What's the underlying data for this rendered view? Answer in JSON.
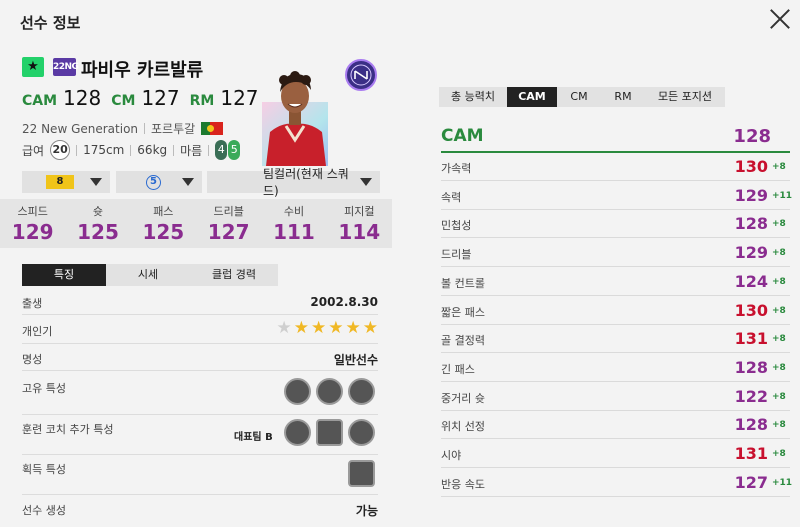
{
  "window": {
    "title": "선수 정보"
  },
  "player": {
    "grade_star": "★",
    "season_badge": "22NG",
    "name": "파비우 카르발류",
    "positions": [
      {
        "label": "CAM",
        "value": "128"
      },
      {
        "label": "CM",
        "value": "127"
      },
      {
        "label": "RM",
        "value": "127"
      }
    ],
    "season_name": "22 New Generation",
    "nation": "포르투갈",
    "salary_label": "급여",
    "salary": "20",
    "height": "175cm",
    "weight": "66kg",
    "body_type": "마름",
    "left_foot": "4",
    "right_foot": "5"
  },
  "selectors": {
    "enhance_level": "8",
    "adaptability": "5",
    "team_color": "팀컬러(현재 스쿼드)"
  },
  "main_stats": [
    {
      "label": "스피드",
      "value": "129"
    },
    {
      "label": "슛",
      "value": "125"
    },
    {
      "label": "패스",
      "value": "125"
    },
    {
      "label": "드리블",
      "value": "127"
    },
    {
      "label": "수비",
      "value": "111"
    },
    {
      "label": "피지컬",
      "value": "114"
    }
  ],
  "tabs": [
    {
      "label": "특징"
    },
    {
      "label": "시세"
    },
    {
      "label": "클럽 경력"
    }
  ],
  "details": {
    "birth_label": "출생",
    "birth_value": "2002.8.30",
    "popularity_label": "개인기",
    "popularity_stars": 5,
    "reputation_label": "명성",
    "reputation_value": "일반선수",
    "unique_trait_label": "고유 특성",
    "coach_trait_label": "훈련 코치 추가 특성",
    "coach_trait_value": "대표팀 B",
    "acquired_trait_label": "획득 특성",
    "generation_label": "선수 생성",
    "generation_value": "가능"
  },
  "right_tabs": [
    {
      "label": "총 능력치"
    },
    {
      "label": "CAM"
    },
    {
      "label": "CM"
    },
    {
      "label": "RM"
    },
    {
      "label": "모든 포지션"
    }
  ],
  "position_summary": {
    "label": "CAM",
    "value": "128"
  },
  "attributes": [
    {
      "name": "가속력",
      "value": "130",
      "bonus": "+8",
      "color": "#c8102e"
    },
    {
      "name": "속력",
      "value": "129",
      "bonus": "+11",
      "color": "#8a2c8f"
    },
    {
      "name": "민첩성",
      "value": "128",
      "bonus": "+8",
      "color": "#8a2c8f"
    },
    {
      "name": "드리블",
      "value": "129",
      "bonus": "+8",
      "color": "#8a2c8f"
    },
    {
      "name": "볼 컨트롤",
      "value": "124",
      "bonus": "+8",
      "color": "#8a2c8f"
    },
    {
      "name": "짧은 패스",
      "value": "130",
      "bonus": "+8",
      "color": "#c8102e"
    },
    {
      "name": "골 결정력",
      "value": "131",
      "bonus": "+8",
      "color": "#c8102e"
    },
    {
      "name": "긴 패스",
      "value": "128",
      "bonus": "+8",
      "color": "#8a2c8f"
    },
    {
      "name": "중거리 슛",
      "value": "122",
      "bonus": "+8",
      "color": "#8a2c8f"
    },
    {
      "name": "위치 선정",
      "value": "128",
      "bonus": "+8",
      "color": "#8a2c8f"
    },
    {
      "name": "시야",
      "value": "131",
      "bonus": "+8",
      "color": "#c8102e"
    },
    {
      "name": "반응 속도",
      "value": "127",
      "bonus": "+11",
      "color": "#8a2c8f"
    }
  ],
  "colors": {
    "accent_green": "#2a8a3e",
    "stat_purple": "#8a2c8f",
    "stat_red": "#c8102e",
    "active_tab": "#222222"
  }
}
